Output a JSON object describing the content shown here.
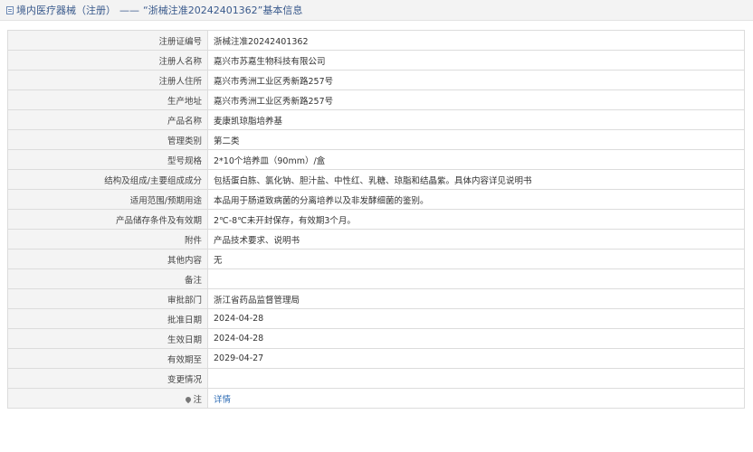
{
  "header": {
    "category": "境内医疗器械（注册）",
    "separator": "——",
    "title": "“浙械注准20242401362”基本信息"
  },
  "rows": [
    {
      "label": "注册证编号",
      "value": "浙械注准20242401362"
    },
    {
      "label": "注册人名称",
      "value": "嘉兴市苏嘉生物科技有限公司"
    },
    {
      "label": "注册人住所",
      "value": "嘉兴市秀洲工业区秀新路257号"
    },
    {
      "label": "生产地址",
      "value": "嘉兴市秀洲工业区秀新路257号"
    },
    {
      "label": "产品名称",
      "value": "麦康凯琼脂培养基"
    },
    {
      "label": "管理类别",
      "value": "第二类"
    },
    {
      "label": "型号规格",
      "value": "2*10个培养皿（90mm）/盒"
    },
    {
      "label": "结构及组成/主要组成成分",
      "value": "包括蛋白胨、氯化钠、胆汁盐、中性红、乳糖、琼脂和结晶紫。具体内容详见说明书"
    },
    {
      "label": "适用范围/预期用途",
      "value": "本品用于肠道致病菌的分离培养以及非发酵细菌的鉴别。"
    },
    {
      "label": "产品储存条件及有效期",
      "value": "2℃-8℃未开封保存，有效期3个月。"
    },
    {
      "label": "附件",
      "value": "产品技术要求、说明书"
    },
    {
      "label": "其他内容",
      "value": "无"
    },
    {
      "label": "备注",
      "value": ""
    },
    {
      "label": "审批部门",
      "value": "浙江省药品监督管理局"
    },
    {
      "label": "批准日期",
      "value": "2024-04-28"
    },
    {
      "label": "生效日期",
      "value": "2024-04-28"
    },
    {
      "label": "有效期至",
      "value": "2029-04-27"
    },
    {
      "label": "变更情况",
      "value": ""
    }
  ],
  "note_row": {
    "icon": "pin-icon",
    "label": "注",
    "link": "详情"
  }
}
